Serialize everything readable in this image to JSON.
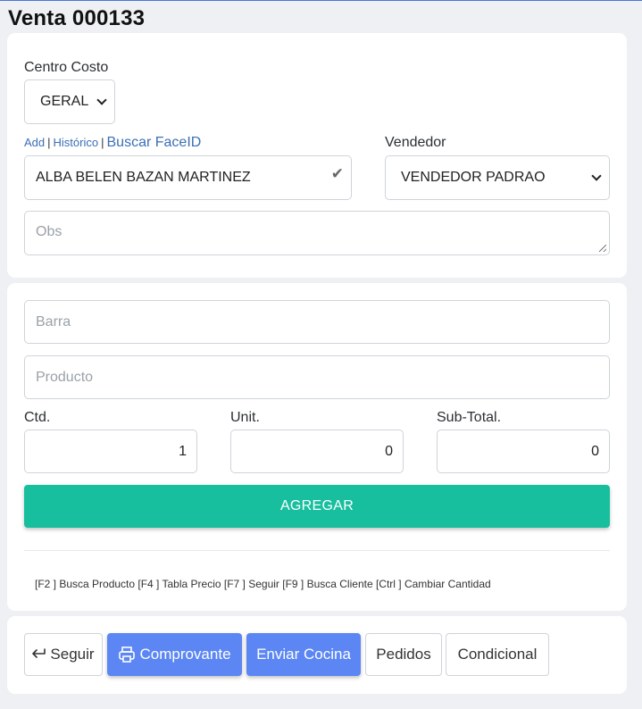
{
  "page": {
    "title": "Venta 000133"
  },
  "header_form": {
    "centro_costo": {
      "label": "Centro Costo",
      "value": "GERAL"
    },
    "links": {
      "add": "Add",
      "sep": "|",
      "historico": "Histórico",
      "buscar": "Buscar FaceID"
    },
    "cliente": {
      "value": "ALBA BELEN BAZAN MARTINEZ"
    },
    "vendedor": {
      "label": "Vendedor",
      "value": "VENDEDOR PADRAO"
    },
    "obs": {
      "placeholder": "Obs"
    }
  },
  "product_form": {
    "barra": {
      "placeholder": "Barra"
    },
    "producto": {
      "placeholder": "Producto"
    },
    "ctd": {
      "label": "Ctd.",
      "value": "1"
    },
    "unit": {
      "label": "Unit.",
      "value": "0"
    },
    "subtotal": {
      "label": "Sub-Total.",
      "value": "0"
    },
    "agregar_label": "AGREGAR",
    "shortcuts": "[F2 ] Busca Producto [F4 ] Tabla Precio [F7 ] Seguir [F9 ] Busca Cliente [Ctrl ] Cambiar Cantidad"
  },
  "actions": {
    "seguir": "Seguir",
    "comprovante": "Comprovante",
    "enviar_cocina": "Enviar Cocina",
    "pedidos": "Pedidos",
    "condicional": "Condicional"
  },
  "colors": {
    "accent_green": "#17bf9f",
    "accent_blue": "#5b86f3",
    "link": "#3b6fb6"
  },
  "icons": {
    "cliente_status": "check-icon",
    "seguir": "arrow-return-icon",
    "comprovante": "printer-icon"
  }
}
